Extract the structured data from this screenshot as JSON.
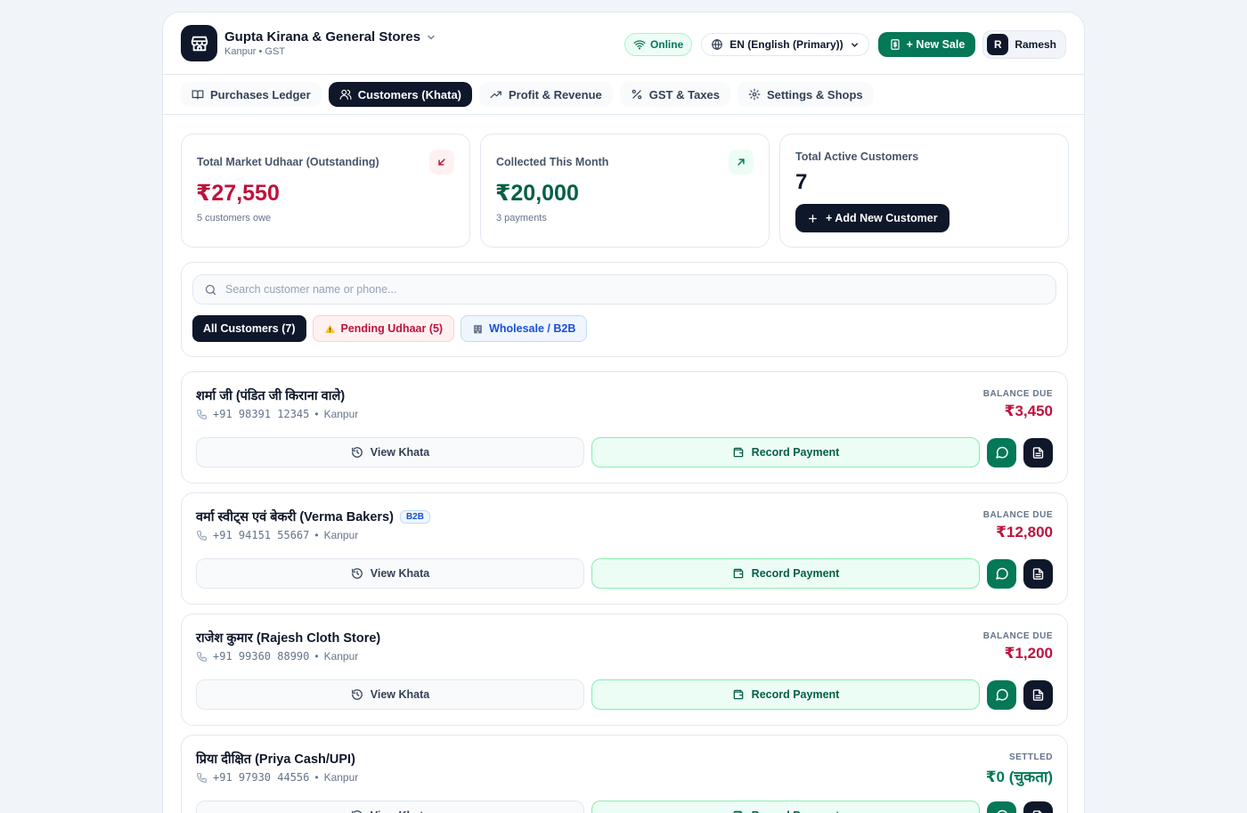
{
  "header": {
    "shop_name": "Gupta Kirana & General Stores",
    "shop_sub": "Kanpur • GST",
    "online_label": "Online",
    "language_label": "EN (English (Primary))",
    "new_sale_label": "+ New Sale",
    "user_initial": "R",
    "user_name": "Ramesh"
  },
  "tabs": [
    {
      "label": "Purchases Ledger",
      "icon": "book-icon",
      "active": false
    },
    {
      "label": "Customers (Khata)",
      "icon": "users-icon",
      "active": true
    },
    {
      "label": "Profit & Revenue",
      "icon": "trending-up-icon",
      "active": false
    },
    {
      "label": "GST & Taxes",
      "icon": "percent-icon",
      "active": false
    },
    {
      "label": "Settings & Shops",
      "icon": "gear-icon",
      "active": false
    }
  ],
  "stats": {
    "udhaar": {
      "label": "Total Market Udhaar (Outstanding)",
      "value": "₹27,550",
      "sub": "5 customers owe"
    },
    "collected": {
      "label": "Collected This Month",
      "value": "₹20,000",
      "sub": "3 payments"
    },
    "active": {
      "label": "Total Active Customers",
      "value": "7",
      "button": "+ Add New Customer"
    }
  },
  "filters": {
    "search_placeholder": "Search customer name or phone...",
    "chips": [
      {
        "label": "All Customers (7)"
      },
      {
        "label": "Pending Udhaar (5)"
      },
      {
        "label": "Wholesale / B2B"
      }
    ]
  },
  "customers": [
    {
      "name": "शर्मा जी (पंडित जी किराना वाले)",
      "tag": "",
      "phone": "+91 98391 12345",
      "city": "Kanpur",
      "balance_label": "BALANCE DUE",
      "balance": "₹3,450",
      "status": "due"
    },
    {
      "name": "वर्मा स्वीट्स एवं बेकरी (Verma Bakers)",
      "tag": "B2B",
      "phone": "+91 94151 55667",
      "city": "Kanpur",
      "balance_label": "BALANCE DUE",
      "balance": "₹12,800",
      "status": "due"
    },
    {
      "name": "राजेश कुमार (Rajesh Cloth Store)",
      "tag": "",
      "phone": "+91 99360 88990",
      "city": "Kanpur",
      "balance_label": "BALANCE DUE",
      "balance": "₹1,200",
      "status": "due"
    },
    {
      "name": "प्रिया दीक्षित (Priya Cash/UPI)",
      "tag": "",
      "phone": "+91 97930 44556",
      "city": "Kanpur",
      "balance_label": "SETTLED",
      "balance": "₹0 (चुकता)",
      "status": "settled"
    }
  ],
  "card_actions": {
    "view_khata": "View Khata",
    "record_payment": "Record Payment"
  },
  "colors": {
    "due": "#be123c",
    "settled": "#047857",
    "primary": "#0f172a",
    "accent": "#047857"
  }
}
